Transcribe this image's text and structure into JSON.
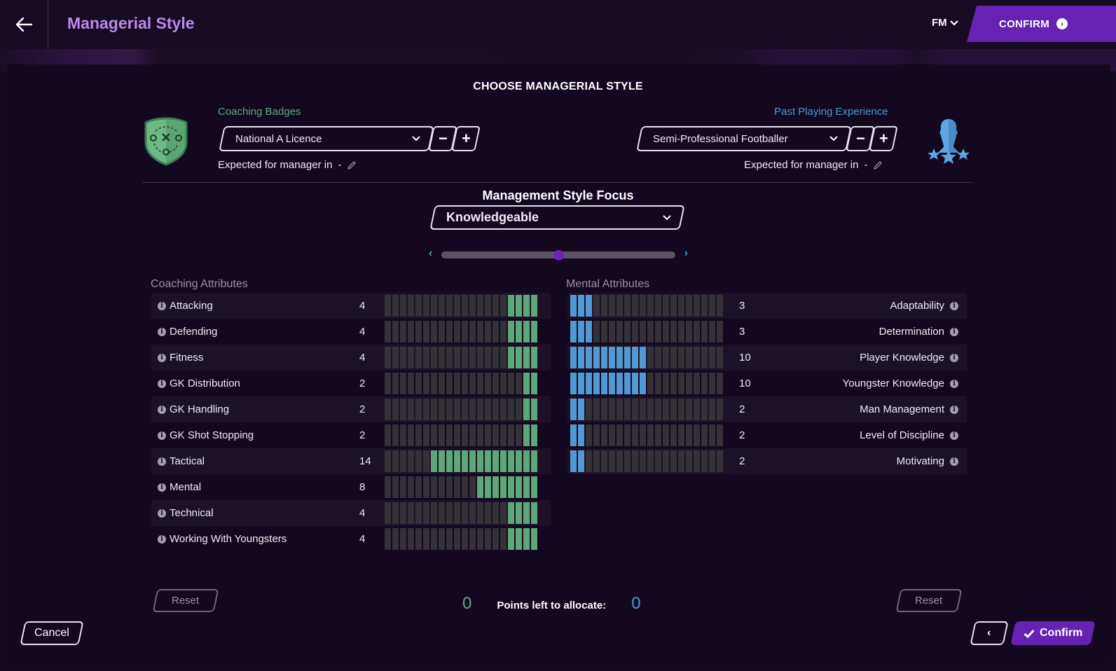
{
  "header": {
    "title": "Managerial Style",
    "menu_label": "FM",
    "confirm_label": "CONFIRM"
  },
  "main": {
    "section_title": "CHOOSE MANAGERIAL STYLE",
    "coaching_badges": {
      "label": "Coaching Badges",
      "selected": "National A Licence",
      "expected_label": "Expected for manager in",
      "expected_value": "-",
      "minus": "−",
      "plus": "+",
      "color": "#5faa7d"
    },
    "past_experience": {
      "label": "Past Playing Experience",
      "selected": "Semi-Professional Footballer",
      "expected_label": "Expected for manager in",
      "expected_value": "-",
      "minus": "−",
      "plus": "+",
      "color": "#4a98d8"
    },
    "focus": {
      "title": "Management Style Focus",
      "selected": "Knowledgeable",
      "slider_position": 0.5
    },
    "max_points": 20,
    "coaching": {
      "heading": "Coaching Attributes",
      "color": "#5ea77a",
      "items": [
        {
          "name": "Attacking",
          "value": 4
        },
        {
          "name": "Defending",
          "value": 4
        },
        {
          "name": "Fitness",
          "value": 4
        },
        {
          "name": "GK Distribution",
          "value": 2
        },
        {
          "name": "GK Handling",
          "value": 2
        },
        {
          "name": "GK Shot Stopping",
          "value": 2
        },
        {
          "name": "Tactical",
          "value": 14
        },
        {
          "name": "Mental",
          "value": 8
        },
        {
          "name": "Technical",
          "value": 4
        },
        {
          "name": "Working With Youngsters",
          "value": 4
        }
      ]
    },
    "mental": {
      "heading": "Mental Attributes",
      "color": "#5199d2",
      "items": [
        {
          "name": "Adaptability",
          "value": 3
        },
        {
          "name": "Determination",
          "value": 3
        },
        {
          "name": "Player Knowledge",
          "value": 10
        },
        {
          "name": "Youngster Knowledge",
          "value": 10
        },
        {
          "name": "Man Management",
          "value": 2
        },
        {
          "name": "Level of Discipline",
          "value": 2
        },
        {
          "name": "Motivating",
          "value": 2
        }
      ]
    },
    "points": {
      "coaching_left": "0",
      "label": "Points left to allocate:",
      "mental_left": "0"
    },
    "reset_label": "Reset"
  },
  "footer": {
    "cancel_label": "Cancel",
    "confirm_label": "Confirm"
  }
}
